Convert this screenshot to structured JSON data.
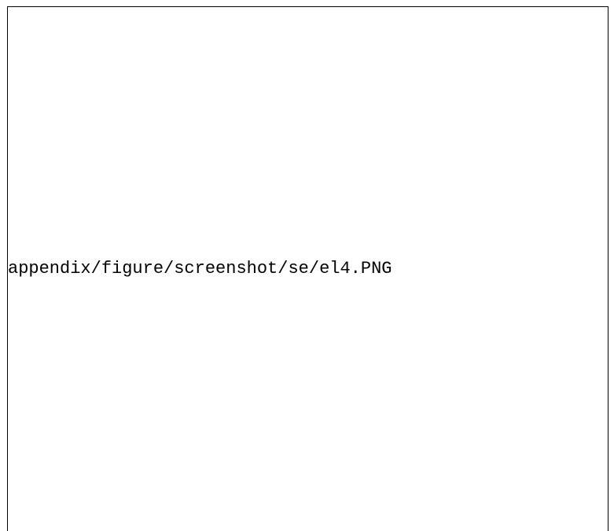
{
  "placeholder": {
    "path_text": "appendix/figure/screenshot/se/el4.PNG"
  },
  "colors": {
    "background": "#ffffff",
    "border": "#000000",
    "text": "#000000"
  }
}
